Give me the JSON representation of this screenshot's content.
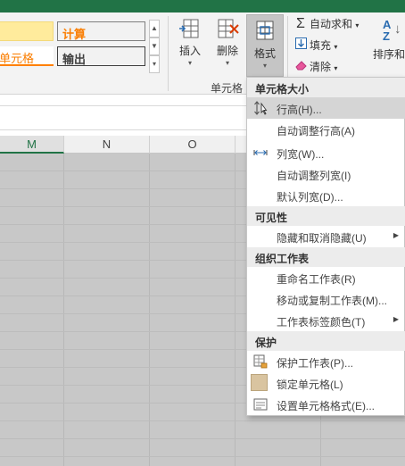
{
  "ribbon": {
    "styles": {
      "normal": "",
      "calc": "计算",
      "cell": "单元格",
      "output": "输出"
    },
    "insert_label": "插入",
    "delete_label": "删除",
    "format_label": "格式",
    "autosum_label": "自动求和",
    "fill_label": "填充",
    "clear_label": "清除",
    "sort_label": "排序和",
    "cells_group_label": "单元格"
  },
  "columns": [
    "M",
    "N",
    "O"
  ],
  "menu": {
    "sec_cell_size": "单元格大小",
    "row_height": "行高(H)...",
    "autofit_row": "自动调整行高(A)",
    "col_width": "列宽(W)...",
    "autofit_col": "自动调整列宽(I)",
    "default_width": "默认列宽(D)...",
    "sec_visibility": "可见性",
    "hide_unhide": "隐藏和取消隐藏(U)",
    "sec_organize": "组织工作表",
    "rename_sheet": "重命名工作表(R)",
    "move_copy": "移动或复制工作表(M)...",
    "tab_color": "工作表标签颜色(T)",
    "sec_protection": "保护",
    "protect_sheet": "保护工作表(P)...",
    "lock_cell": "锁定单元格(L)",
    "format_cells": "设置单元格格式(E)..."
  },
  "colors": {
    "excel_green": "#217346",
    "menu_hover": "#d5d5d5"
  }
}
